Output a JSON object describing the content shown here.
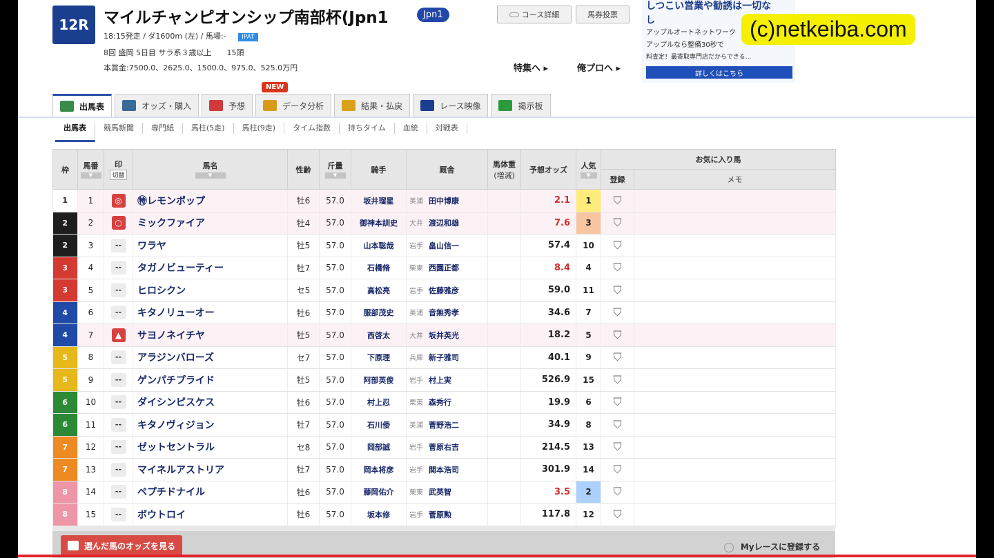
{
  "race": {
    "number": "12R",
    "title": "マイルチャンピオンシップ南部杯(Jpn1",
    "grade": "Jpn1",
    "info1": "18:15発走 / ダ1600m (左) / 馬場:-",
    "ipat": "IPAT",
    "info2": "8回 盛岡 5日目 サラ系３歳以上　　15頭",
    "info3": "本賞金:7500.0、2625.0、1500.0、975.0、525.0万円"
  },
  "header_links": {
    "course_detail": "コース詳細",
    "ticket_buy": "馬券投票",
    "special": "特集へ ▸",
    "blog": "俺プロへ ▸"
  },
  "ad": {
    "line1": "しつこい営業や勧誘は一切な",
    "line2": "し",
    "line3": "アップルオートネットワーク",
    "line4": "アップルなら整備30秒で",
    "line5": "料査定！最寄取専門店だからできる…",
    "button": "詳しくはこちら"
  },
  "watermark": "(c)netkeiba.com",
  "tabs": [
    {
      "label": "出馬表",
      "icon": "table-icon",
      "color": "#3a8a4a"
    },
    {
      "label": "オッズ・購入",
      "icon": "odds-icon",
      "color": "#3a6a9a"
    },
    {
      "label": "予想",
      "icon": "target-icon",
      "color": "#d03a3a"
    },
    {
      "label": "データ分析",
      "icon": "bar-chart-icon",
      "color": "#d99a1a"
    },
    {
      "label": "結果・払戻",
      "icon": "trophy-icon",
      "color": "#d9a21a"
    },
    {
      "label": "レース映像",
      "icon": "video-icon",
      "color": "#1b3f8f"
    },
    {
      "label": "掲示板",
      "icon": "chat-icon",
      "color": "#2b9a3a"
    }
  ],
  "new_badge": "NEW",
  "subtabs": [
    "出馬表",
    "競馬新聞",
    "専門紙",
    "馬柱(5走)",
    "馬柱(9走)",
    "タイム指数",
    "持ちタイム",
    "血統",
    "対戦表"
  ],
  "table": {
    "headers": {
      "waku": "枠",
      "umaban": "馬番",
      "mark": "印",
      "mark_sub": "切替",
      "name": "馬名",
      "sexage": "性齢",
      "weight": "斤量",
      "jockey": "騎手",
      "trainer": "厩舎",
      "bodyweight": "馬体重",
      "bodyweight_sub": "(増減)",
      "odds": "予想オッズ",
      "pop": "人気",
      "favorite": "お気に入り馬",
      "register": "登録",
      "memo": "メモ"
    },
    "rows": [
      {
        "waku": "1",
        "umaban": "1",
        "mark": "◎",
        "name": "㊕レモンポップ",
        "sexage": "牡6",
        "weight": "57.0",
        "jockey": "坂井瑠星",
        "stable": "美浦",
        "trainer": "田中博康",
        "odds": "2.1",
        "pop": "1"
      },
      {
        "waku": "2",
        "umaban": "2",
        "mark": "○",
        "name": "ミックファイア",
        "sexage": "牡4",
        "weight": "57.0",
        "jockey": "御神本訓史",
        "stable": "大井",
        "trainer": "渡辺和雄",
        "odds": "7.6",
        "pop": "3"
      },
      {
        "waku": "2",
        "umaban": "3",
        "mark": "--",
        "name": "ワラヤ",
        "sexage": "牡5",
        "weight": "57.0",
        "jockey": "山本聡哉",
        "stable": "岩手",
        "trainer": "畠山信一",
        "odds": "57.4",
        "pop": "10"
      },
      {
        "waku": "3",
        "umaban": "4",
        "mark": "--",
        "name": "タガノビューティー",
        "sexage": "牡7",
        "weight": "57.0",
        "jockey": "石橋脩",
        "stable": "栗東",
        "trainer": "西園正都",
        "odds": "8.4",
        "pop": "4"
      },
      {
        "waku": "3",
        "umaban": "5",
        "mark": "--",
        "name": "ヒロシクン",
        "sexage": "セ5",
        "weight": "57.0",
        "jockey": "高松亮",
        "stable": "岩手",
        "trainer": "佐藤雅彦",
        "odds": "59.0",
        "pop": "11"
      },
      {
        "waku": "4",
        "umaban": "6",
        "mark": "--",
        "name": "キタノリューオー",
        "sexage": "牡6",
        "weight": "57.0",
        "jockey": "服部茂史",
        "stable": "美浦",
        "trainer": "音無秀孝",
        "odds": "34.6",
        "pop": "7"
      },
      {
        "waku": "4",
        "umaban": "7",
        "mark": "▲",
        "name": "サヨノネイチヤ",
        "sexage": "牡5",
        "weight": "57.0",
        "jockey": "西啓太",
        "stable": "大井",
        "trainer": "坂井英光",
        "odds": "18.2",
        "pop": "5"
      },
      {
        "waku": "5",
        "umaban": "8",
        "mark": "--",
        "name": "アラジンバローズ",
        "sexage": "セ7",
        "weight": "57.0",
        "jockey": "下原理",
        "stable": "兵庫",
        "trainer": "新子雅司",
        "odds": "40.1",
        "pop": "9"
      },
      {
        "waku": "5",
        "umaban": "9",
        "mark": "--",
        "name": "ゲンパチプライド",
        "sexage": "牡5",
        "weight": "57.0",
        "jockey": "阿部英俊",
        "stable": "岩手",
        "trainer": "村上実",
        "odds": "526.9",
        "pop": "15"
      },
      {
        "waku": "6",
        "umaban": "10",
        "mark": "--",
        "name": "ダイシンピスケス",
        "sexage": "牡6",
        "weight": "57.0",
        "jockey": "村上忍",
        "stable": "栗東",
        "trainer": "森秀行",
        "odds": "19.9",
        "pop": "6"
      },
      {
        "waku": "6",
        "umaban": "11",
        "mark": "--",
        "name": "キタノヴィジョン",
        "sexage": "牡7",
        "weight": "57.0",
        "jockey": "石川倭",
        "stable": "美浦",
        "trainer": "菅野浩二",
        "odds": "34.9",
        "pop": "8"
      },
      {
        "waku": "7",
        "umaban": "12",
        "mark": "--",
        "name": "ゼットセントラル",
        "sexage": "セ8",
        "weight": "57.0",
        "jockey": "岡部誠",
        "stable": "岩手",
        "trainer": "菅原右吉",
        "odds": "214.5",
        "pop": "13"
      },
      {
        "waku": "7",
        "umaban": "13",
        "mark": "--",
        "name": "マイネルアストリア",
        "sexage": "牡7",
        "weight": "57.0",
        "jockey": "岡本将彦",
        "stable": "岩手",
        "trainer": "関本浩司",
        "odds": "301.9",
        "pop": "14"
      },
      {
        "waku": "8",
        "umaban": "14",
        "mark": "--",
        "name": "ペプチドナイル",
        "sexage": "牡6",
        "weight": "57.0",
        "jockey": "藤岡佑介",
        "stable": "栗東",
        "trainer": "武英智",
        "odds": "3.5",
        "pop": "2"
      },
      {
        "waku": "8",
        "umaban": "15",
        "mark": "--",
        "name": "ボウトロイ",
        "sexage": "牡6",
        "weight": "57.0",
        "jockey": "坂本修",
        "stable": "岩手",
        "trainer": "菅原勲",
        "odds": "117.8",
        "pop": "12"
      }
    ]
  },
  "bottom": {
    "button": "選んだ馬のオッズを見る",
    "my_race": "Myレースに登録する"
  },
  "colors": {
    "waku": {
      "1": "#ffffff",
      "2": "#1e1e1e",
      "3": "#d43a32",
      "4": "#1f4aa8",
      "5": "#e6b81a",
      "6": "#2c8a36",
      "7": "#ee8a22",
      "8": "#ee96a8"
    },
    "mark": {
      "◎": "#d84040",
      "○": "#d84040",
      "▲": "#d84040"
    },
    "accent": "#2b50a8"
  }
}
